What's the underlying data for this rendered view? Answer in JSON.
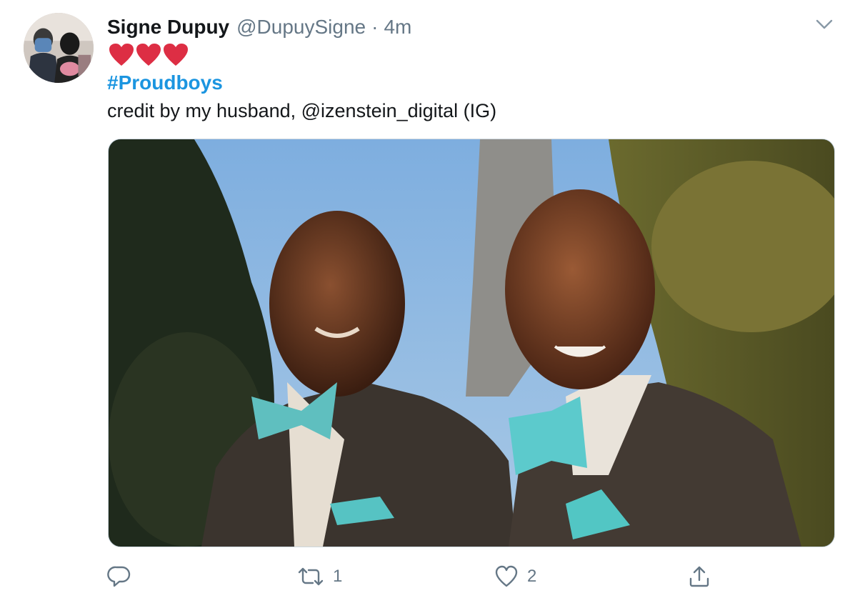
{
  "tweet": {
    "author": {
      "display_name": "Signe Dupuy",
      "handle": "@DupuySigne",
      "separator": "·",
      "time": "4m"
    },
    "emoji": [
      "❤️",
      "❤️",
      "❤️"
    ],
    "hashtag": "#Proudboys",
    "text": "credit by my husband, @izenstein_digital (IG)",
    "actions": {
      "reply_count": "",
      "retweet_count": "1",
      "like_count": "2"
    }
  },
  "colors": {
    "accent": "#1b95e0",
    "muted": "#657786",
    "heart": "#e0245e"
  },
  "icons": [
    "avatar-photo",
    "chevron-down-icon",
    "heart-emoji-icon",
    "reply-icon",
    "retweet-icon",
    "like-icon",
    "share-icon"
  ]
}
